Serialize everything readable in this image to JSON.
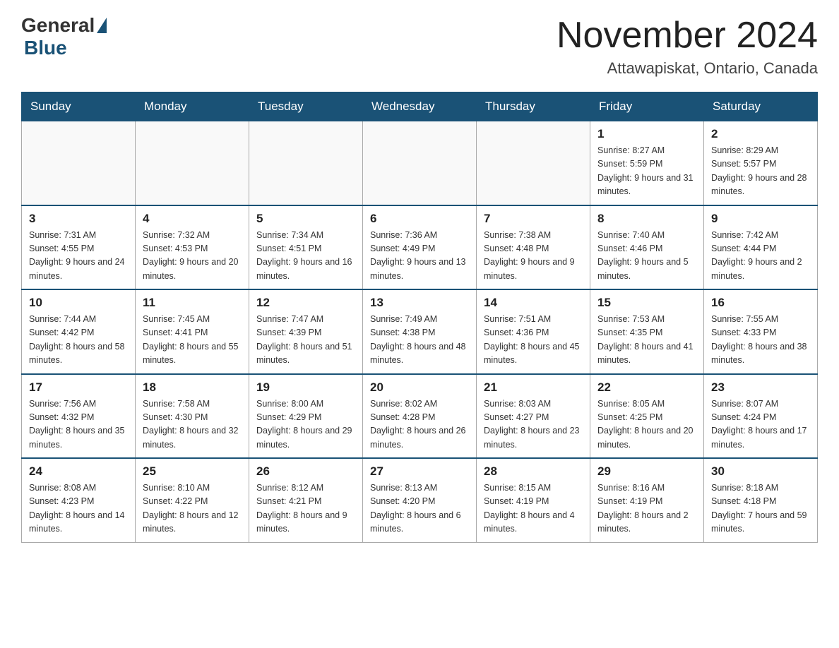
{
  "header": {
    "logo_general": "General",
    "logo_blue": "Blue",
    "month_title": "November 2024",
    "location": "Attawapiskat, Ontario, Canada"
  },
  "weekdays": [
    "Sunday",
    "Monday",
    "Tuesday",
    "Wednesday",
    "Thursday",
    "Friday",
    "Saturday"
  ],
  "weeks": [
    [
      {
        "day": "",
        "info": ""
      },
      {
        "day": "",
        "info": ""
      },
      {
        "day": "",
        "info": ""
      },
      {
        "day": "",
        "info": ""
      },
      {
        "day": "",
        "info": ""
      },
      {
        "day": "1",
        "info": "Sunrise: 8:27 AM\nSunset: 5:59 PM\nDaylight: 9 hours and 31 minutes."
      },
      {
        "day": "2",
        "info": "Sunrise: 8:29 AM\nSunset: 5:57 PM\nDaylight: 9 hours and 28 minutes."
      }
    ],
    [
      {
        "day": "3",
        "info": "Sunrise: 7:31 AM\nSunset: 4:55 PM\nDaylight: 9 hours and 24 minutes."
      },
      {
        "day": "4",
        "info": "Sunrise: 7:32 AM\nSunset: 4:53 PM\nDaylight: 9 hours and 20 minutes."
      },
      {
        "day": "5",
        "info": "Sunrise: 7:34 AM\nSunset: 4:51 PM\nDaylight: 9 hours and 16 minutes."
      },
      {
        "day": "6",
        "info": "Sunrise: 7:36 AM\nSunset: 4:49 PM\nDaylight: 9 hours and 13 minutes."
      },
      {
        "day": "7",
        "info": "Sunrise: 7:38 AM\nSunset: 4:48 PM\nDaylight: 9 hours and 9 minutes."
      },
      {
        "day": "8",
        "info": "Sunrise: 7:40 AM\nSunset: 4:46 PM\nDaylight: 9 hours and 5 minutes."
      },
      {
        "day": "9",
        "info": "Sunrise: 7:42 AM\nSunset: 4:44 PM\nDaylight: 9 hours and 2 minutes."
      }
    ],
    [
      {
        "day": "10",
        "info": "Sunrise: 7:44 AM\nSunset: 4:42 PM\nDaylight: 8 hours and 58 minutes."
      },
      {
        "day": "11",
        "info": "Sunrise: 7:45 AM\nSunset: 4:41 PM\nDaylight: 8 hours and 55 minutes."
      },
      {
        "day": "12",
        "info": "Sunrise: 7:47 AM\nSunset: 4:39 PM\nDaylight: 8 hours and 51 minutes."
      },
      {
        "day": "13",
        "info": "Sunrise: 7:49 AM\nSunset: 4:38 PM\nDaylight: 8 hours and 48 minutes."
      },
      {
        "day": "14",
        "info": "Sunrise: 7:51 AM\nSunset: 4:36 PM\nDaylight: 8 hours and 45 minutes."
      },
      {
        "day": "15",
        "info": "Sunrise: 7:53 AM\nSunset: 4:35 PM\nDaylight: 8 hours and 41 minutes."
      },
      {
        "day": "16",
        "info": "Sunrise: 7:55 AM\nSunset: 4:33 PM\nDaylight: 8 hours and 38 minutes."
      }
    ],
    [
      {
        "day": "17",
        "info": "Sunrise: 7:56 AM\nSunset: 4:32 PM\nDaylight: 8 hours and 35 minutes."
      },
      {
        "day": "18",
        "info": "Sunrise: 7:58 AM\nSunset: 4:30 PM\nDaylight: 8 hours and 32 minutes."
      },
      {
        "day": "19",
        "info": "Sunrise: 8:00 AM\nSunset: 4:29 PM\nDaylight: 8 hours and 29 minutes."
      },
      {
        "day": "20",
        "info": "Sunrise: 8:02 AM\nSunset: 4:28 PM\nDaylight: 8 hours and 26 minutes."
      },
      {
        "day": "21",
        "info": "Sunrise: 8:03 AM\nSunset: 4:27 PM\nDaylight: 8 hours and 23 minutes."
      },
      {
        "day": "22",
        "info": "Sunrise: 8:05 AM\nSunset: 4:25 PM\nDaylight: 8 hours and 20 minutes."
      },
      {
        "day": "23",
        "info": "Sunrise: 8:07 AM\nSunset: 4:24 PM\nDaylight: 8 hours and 17 minutes."
      }
    ],
    [
      {
        "day": "24",
        "info": "Sunrise: 8:08 AM\nSunset: 4:23 PM\nDaylight: 8 hours and 14 minutes."
      },
      {
        "day": "25",
        "info": "Sunrise: 8:10 AM\nSunset: 4:22 PM\nDaylight: 8 hours and 12 minutes."
      },
      {
        "day": "26",
        "info": "Sunrise: 8:12 AM\nSunset: 4:21 PM\nDaylight: 8 hours and 9 minutes."
      },
      {
        "day": "27",
        "info": "Sunrise: 8:13 AM\nSunset: 4:20 PM\nDaylight: 8 hours and 6 minutes."
      },
      {
        "day": "28",
        "info": "Sunrise: 8:15 AM\nSunset: 4:19 PM\nDaylight: 8 hours and 4 minutes."
      },
      {
        "day": "29",
        "info": "Sunrise: 8:16 AM\nSunset: 4:19 PM\nDaylight: 8 hours and 2 minutes."
      },
      {
        "day": "30",
        "info": "Sunrise: 8:18 AM\nSunset: 4:18 PM\nDaylight: 7 hours and 59 minutes."
      }
    ]
  ]
}
